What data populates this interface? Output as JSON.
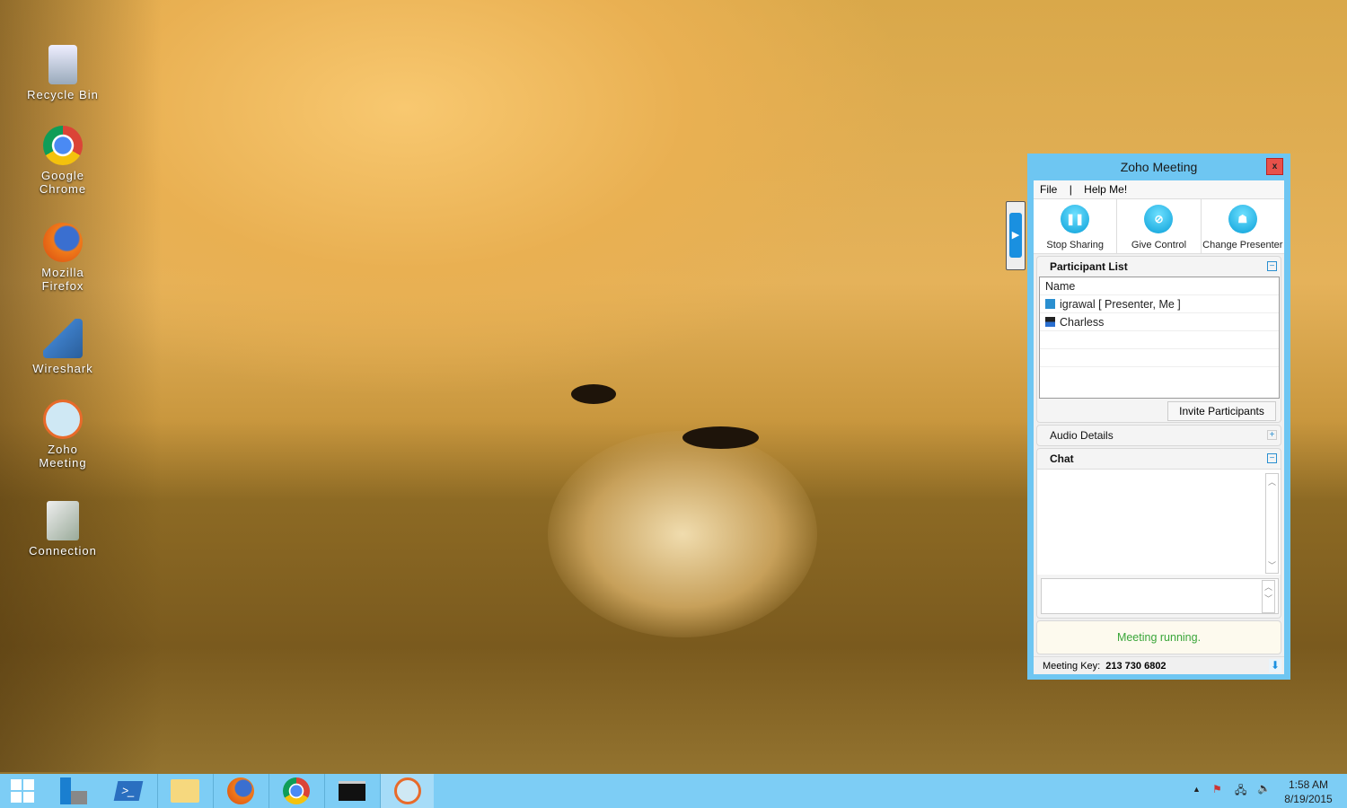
{
  "desktop": {
    "icons": [
      {
        "label": "Recycle Bin"
      },
      {
        "label": "Google Chrome"
      },
      {
        "label": "Mozilla Firefox"
      },
      {
        "label": "Wireshark"
      },
      {
        "label": "Zoho Meeting"
      },
      {
        "label": "Connection"
      }
    ]
  },
  "window": {
    "title": "Zoho Meeting",
    "close_label": "x",
    "menu": {
      "file": "File",
      "sep": "|",
      "help": "Help Me!"
    },
    "toolbar": {
      "stop_sharing": "Stop Sharing",
      "give_control": "Give Control",
      "change_presenter": "Change Presenter"
    },
    "participants": {
      "title": "Participant List",
      "column": "Name",
      "rows": [
        "igrawal [ Presenter, Me ]",
        "Charless"
      ],
      "invite": "Invite Participants"
    },
    "audio": {
      "title": "Audio Details"
    },
    "chat": {
      "title": "Chat",
      "input_value": ""
    },
    "status": "Meeting running.",
    "footer": {
      "key_label": "Meeting Key:",
      "key_value": "213 730 6802"
    }
  },
  "tray": {
    "time": "1:58 AM",
    "date": "8/19/2015"
  },
  "colors": {
    "accent": "#6ec6f2",
    "taskbar": "#7dcdf5",
    "status_green": "#3aa63a"
  }
}
